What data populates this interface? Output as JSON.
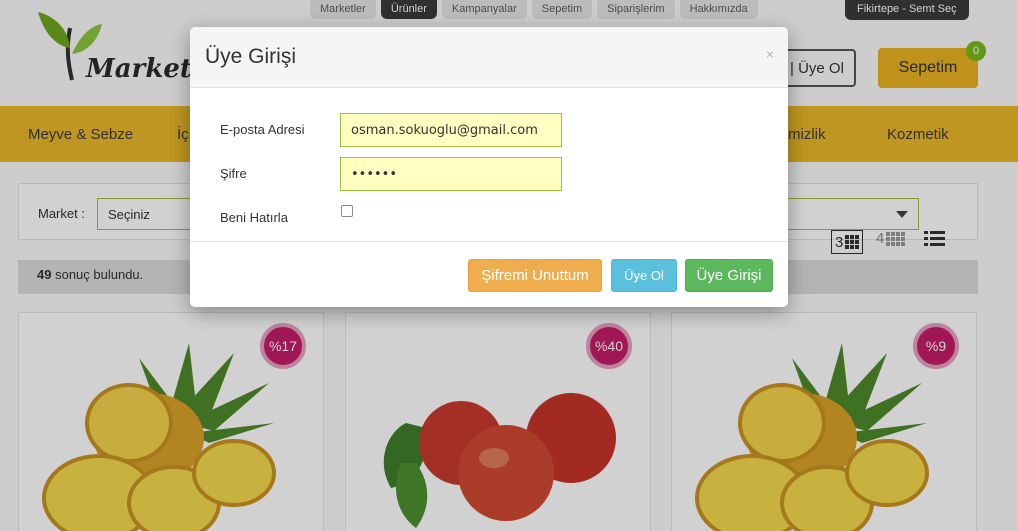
{
  "top_nav": {
    "tabs": [
      {
        "label": "Marketler",
        "active": false
      },
      {
        "label": "Ürünler",
        "active": true
      },
      {
        "label": "Kampanyalar",
        "active": false
      },
      {
        "label": "Sepetim",
        "active": false
      },
      {
        "label": "Siparişlerim",
        "active": false
      },
      {
        "label": "Hakkımızda",
        "active": false
      }
    ],
    "district_button": "Fikirtepe - Semt Seç"
  },
  "header": {
    "logo_text": "Market",
    "login_register_text": "| Üye Ol",
    "cart_label": "Sepetim",
    "cart_count": "0"
  },
  "category_bar": {
    "items": [
      "Meyve & Sebze",
      "İç",
      "mizlik",
      "Kozmetik"
    ]
  },
  "filters": {
    "market_label": "Market :",
    "market_selected": "Seçiniz"
  },
  "view_options": {
    "grid3_label": "3",
    "grid4_label": "4"
  },
  "results": {
    "count": "49",
    "text": "sonuç bulundu."
  },
  "products": [
    {
      "discount": "%17",
      "image": "pineapple"
    },
    {
      "discount": "%40",
      "image": "apples"
    },
    {
      "discount": "%9",
      "image": "pineapple"
    }
  ],
  "modal": {
    "title": "Üye Girişi",
    "close_symbol": "×",
    "email_label": "E-posta Adresi",
    "email_value": "osman.sokuoglu@gmail.com",
    "password_label": "Şifre",
    "password_value": "••••••",
    "remember_label": "Beni Hatırla",
    "remember_checked": false,
    "forgot_button": "Şifremi Unuttum",
    "register_button": "Üye Ol",
    "login_button": "Üye Girişi"
  },
  "colors": {
    "accent_yellow": "#e9b82a",
    "cart_badge": "#79b91b",
    "discount_badge": "#c41d6a",
    "btn_warning": "#f0ad4e",
    "btn_info": "#5bc0de",
    "btn_success": "#5cb85c",
    "field_bg": "#ffffc2"
  }
}
